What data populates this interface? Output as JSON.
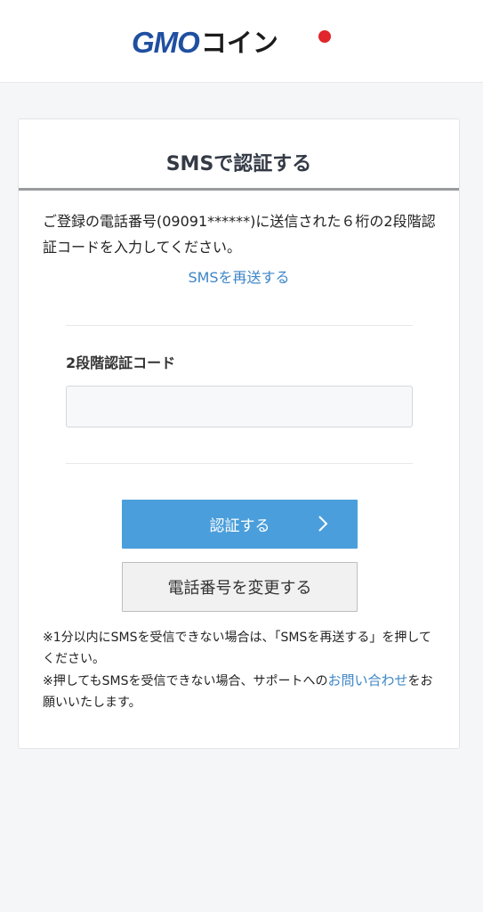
{
  "header": {
    "logo_gmo": "GMO",
    "logo_coin": "コイン"
  },
  "card": {
    "title": "SMSで認証する",
    "message": "ご登録の電話番号(09091******)に送信された６桁の2段階認証コードを入力してください。",
    "resend_link": "SMSを再送する",
    "code_label": "2段階認証コード",
    "code_value": "",
    "code_placeholder": "",
    "verify_button": "認証する",
    "change_phone_button": "電話番号を変更する",
    "notes": {
      "line1": "※1分以内にSMSを受信できない場合は、「SMSを再送する」を押してください。",
      "line2_prefix": "※押してもSMSを受信できない場合、サポートへの",
      "line2_link": "お問い合わせ",
      "line2_suffix": "をお願いいたします。"
    }
  },
  "colors": {
    "accent": "#4a9edb",
    "link": "#3d86c6",
    "brand_blue": "#1f4fa0",
    "brand_red": "#e0262b"
  }
}
